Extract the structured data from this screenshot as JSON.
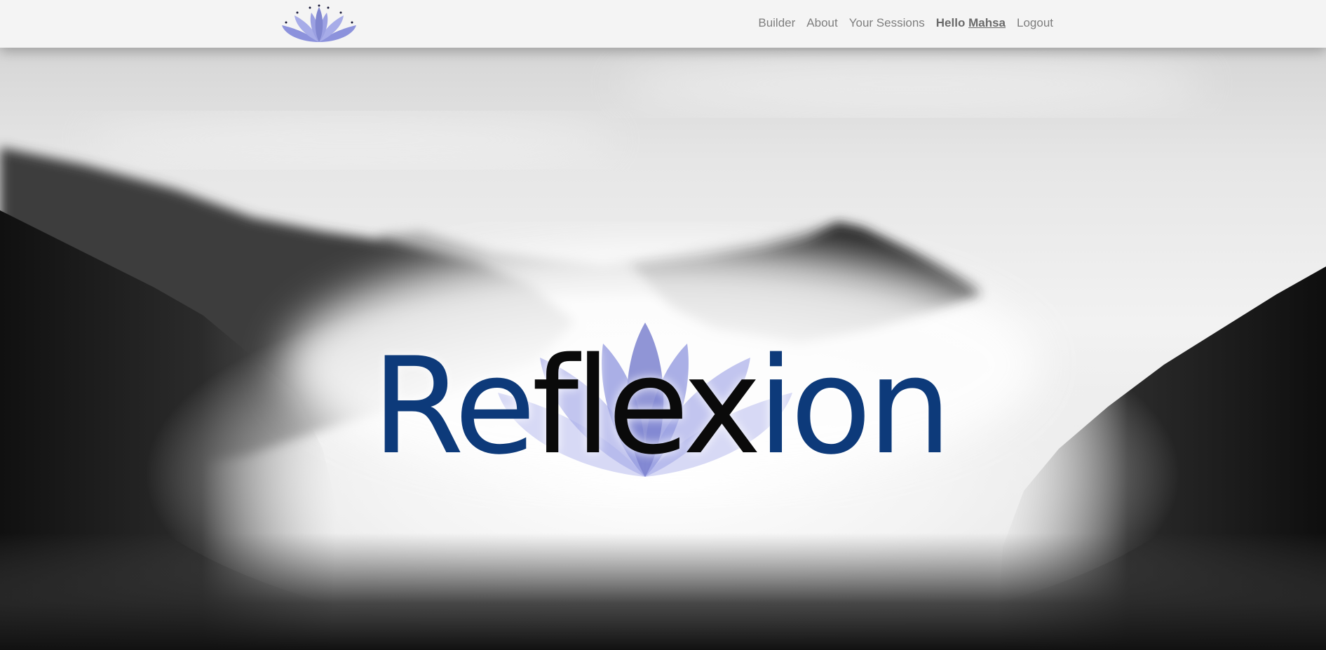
{
  "nav": {
    "brand_icon": "lotus-icon",
    "links": {
      "builder": "Builder",
      "about": "About",
      "sessions": "Your Sessions",
      "greeting_prefix": "Hello",
      "greeting_user": "Mahsa",
      "logout": "Logout"
    }
  },
  "hero": {
    "title_part1": "Re",
    "title_part2": "flex",
    "title_part3": "ion",
    "logo_icon": "lotus-icon"
  },
  "colors": {
    "brand_blue": "#0d3a7a",
    "lotus_purple": "#7b82d8",
    "navbar_bg": "#f4f4f4",
    "nav_text": "#7e7e7e"
  }
}
